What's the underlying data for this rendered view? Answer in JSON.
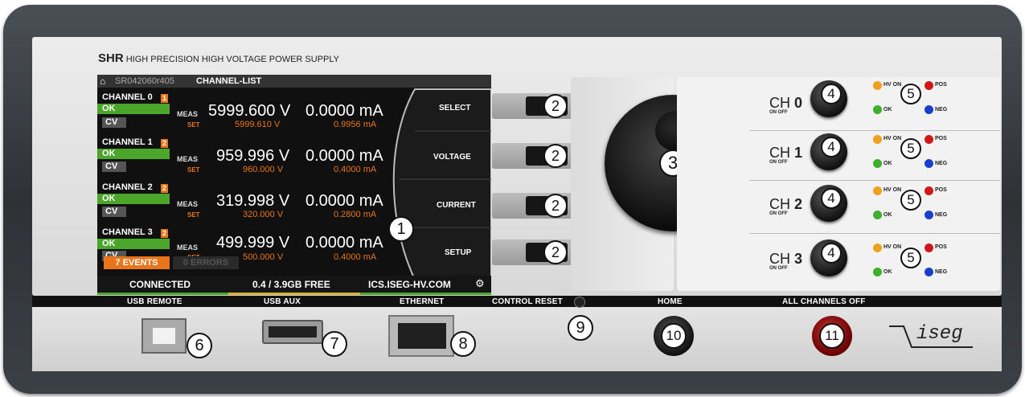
{
  "brand": {
    "model": "SHR",
    "subtitle": "HIGH PRECISION HIGH VOLTAGE POWER SUPPLY"
  },
  "screen": {
    "serial": "SR042060r405",
    "view": "CHANNEL-LIST",
    "channels": [
      {
        "name": "CHANNEL 0",
        "badge": "1",
        "status": "OK",
        "mode": "CV",
        "meas_label": "MEAS",
        "set_label": "SET",
        "meas_v": "5999.600 V",
        "meas_i": "0.0000 mA",
        "set_v": "5999.610 V",
        "set_i": "0.9956 mA"
      },
      {
        "name": "CHANNEL 1",
        "badge": "2",
        "status": "OK",
        "mode": "CV",
        "meas_label": "MEAS",
        "set_label": "SET",
        "meas_v": "959.996 V",
        "meas_i": "0.0000 mA",
        "set_v": "960.000 V",
        "set_i": "0.4000 mA"
      },
      {
        "name": "CHANNEL 2",
        "badge": "2",
        "status": "OK",
        "mode": "CV",
        "meas_label": "MEAS",
        "set_label": "SET",
        "meas_v": "319.998 V",
        "meas_i": "0.0000 mA",
        "set_v": "320.000 V",
        "set_i": "0.2800 mA"
      },
      {
        "name": "CHANNEL 3",
        "badge": "2",
        "status": "OK",
        "mode": "CV",
        "meas_label": "MEAS",
        "set_label": "SET",
        "meas_v": "499.999 V",
        "meas_i": "0.0000 mA",
        "set_v": "500.000 V",
        "set_i": "0.4000 mA"
      }
    ],
    "events": "7 EVENTS",
    "errors": "0 ERRORS",
    "status_bar": {
      "connection": "CONNECTED",
      "storage": "0.4 / 3.9GB FREE",
      "host": "ICS.ISEG-HV.COM"
    },
    "menu": [
      "SELECT",
      "VOLTAGE",
      "CURRENT",
      "SETUP"
    ]
  },
  "callouts": {
    "screen": "1",
    "soft_key": "2",
    "knob": "3",
    "channel_switch": "4",
    "leds": "5",
    "usb_remote": "6",
    "usb_aux": "7",
    "ethernet": "8",
    "control_reset": "9",
    "home": "10",
    "all_off": "11"
  },
  "channels": [
    {
      "prefix": "CH",
      "num": "0",
      "onoff": "ON OFF"
    },
    {
      "prefix": "CH",
      "num": "1",
      "onoff": "ON OFF"
    },
    {
      "prefix": "CH",
      "num": "2",
      "onoff": "ON OFF"
    },
    {
      "prefix": "CH",
      "num": "3",
      "onoff": "ON OFF"
    }
  ],
  "led_labels": {
    "hv_on": "HV ON",
    "pos": "POS",
    "ok": "OK",
    "neg": "NEG"
  },
  "ports": {
    "usb_remote": "USB REMOTE",
    "usb_aux": "USB AUX",
    "ethernet": "ETHERNET",
    "control_reset": "CONTROL RESET",
    "home": "HOME",
    "all_off": "ALL CHANNELS OFF"
  },
  "logo": "iseg",
  "colors": {
    "ok_green": "#4aa52a",
    "accent_orange": "#e8751a",
    "led_orange": "#f0a020",
    "led_red": "#d01818",
    "led_green": "#3cb02a",
    "led_blue": "#1840c8"
  }
}
